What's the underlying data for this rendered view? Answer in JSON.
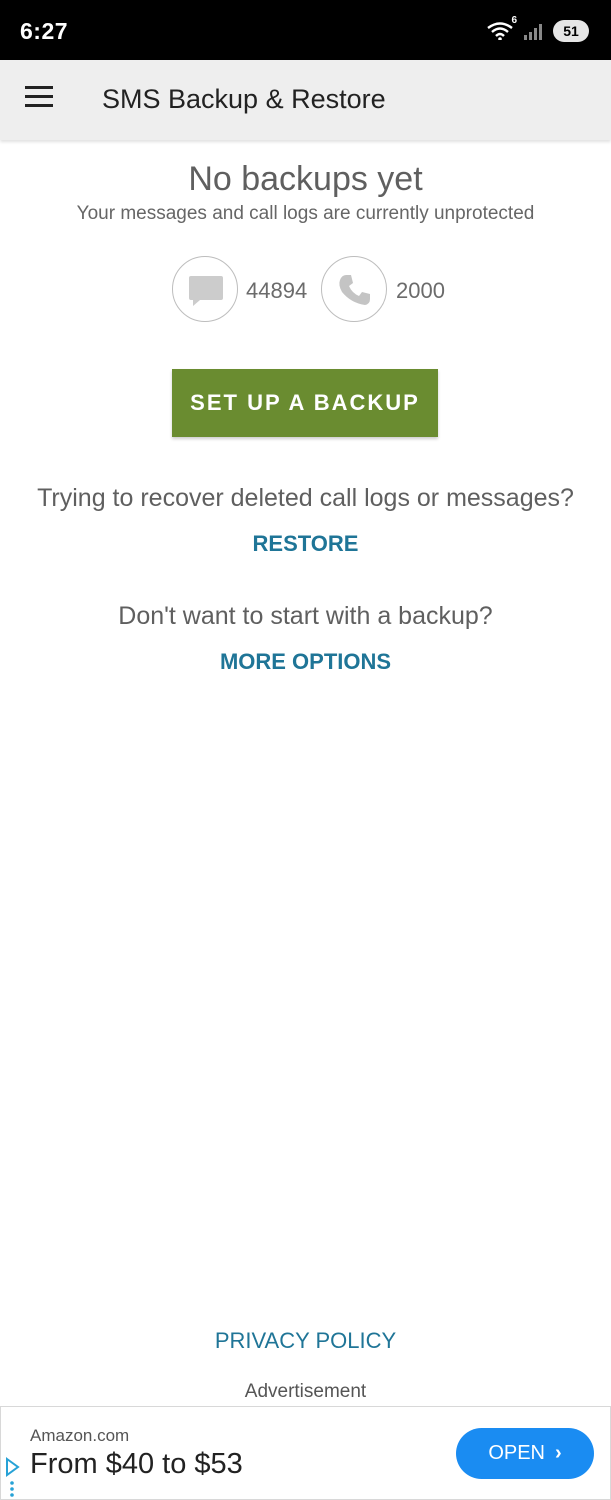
{
  "status_bar": {
    "time": "6:27",
    "wifi_superscript": "6",
    "battery": "51"
  },
  "app_bar": {
    "title": "SMS Backup & Restore"
  },
  "main": {
    "headline": "No backups yet",
    "subline": "Your messages and call logs are currently unprotected",
    "message_count": "44894",
    "call_count": "2000",
    "setup_button": "SET UP A BACKUP",
    "recover_prompt": "Trying to recover deleted call logs or messages?",
    "restore_link": "RESTORE",
    "start_prompt": "Don't want to start with a backup?",
    "more_options_link": "MORE OPTIONS",
    "privacy_link": "PRIVACY POLICY",
    "ad_label": "Advertisement"
  },
  "ad": {
    "source": "Amazon.com",
    "headline": "From $40 to $53",
    "button": "OPEN"
  },
  "colors": {
    "accent_green": "#6a8c30",
    "link_blue": "#1f7597",
    "ad_button_blue": "#1a8cf2"
  },
  "icons": [
    "hamburger-menu-icon",
    "message-icon",
    "phone-icon",
    "wifi-icon",
    "signal-icon",
    "adchoices-icon",
    "chevron-right-icon"
  ]
}
